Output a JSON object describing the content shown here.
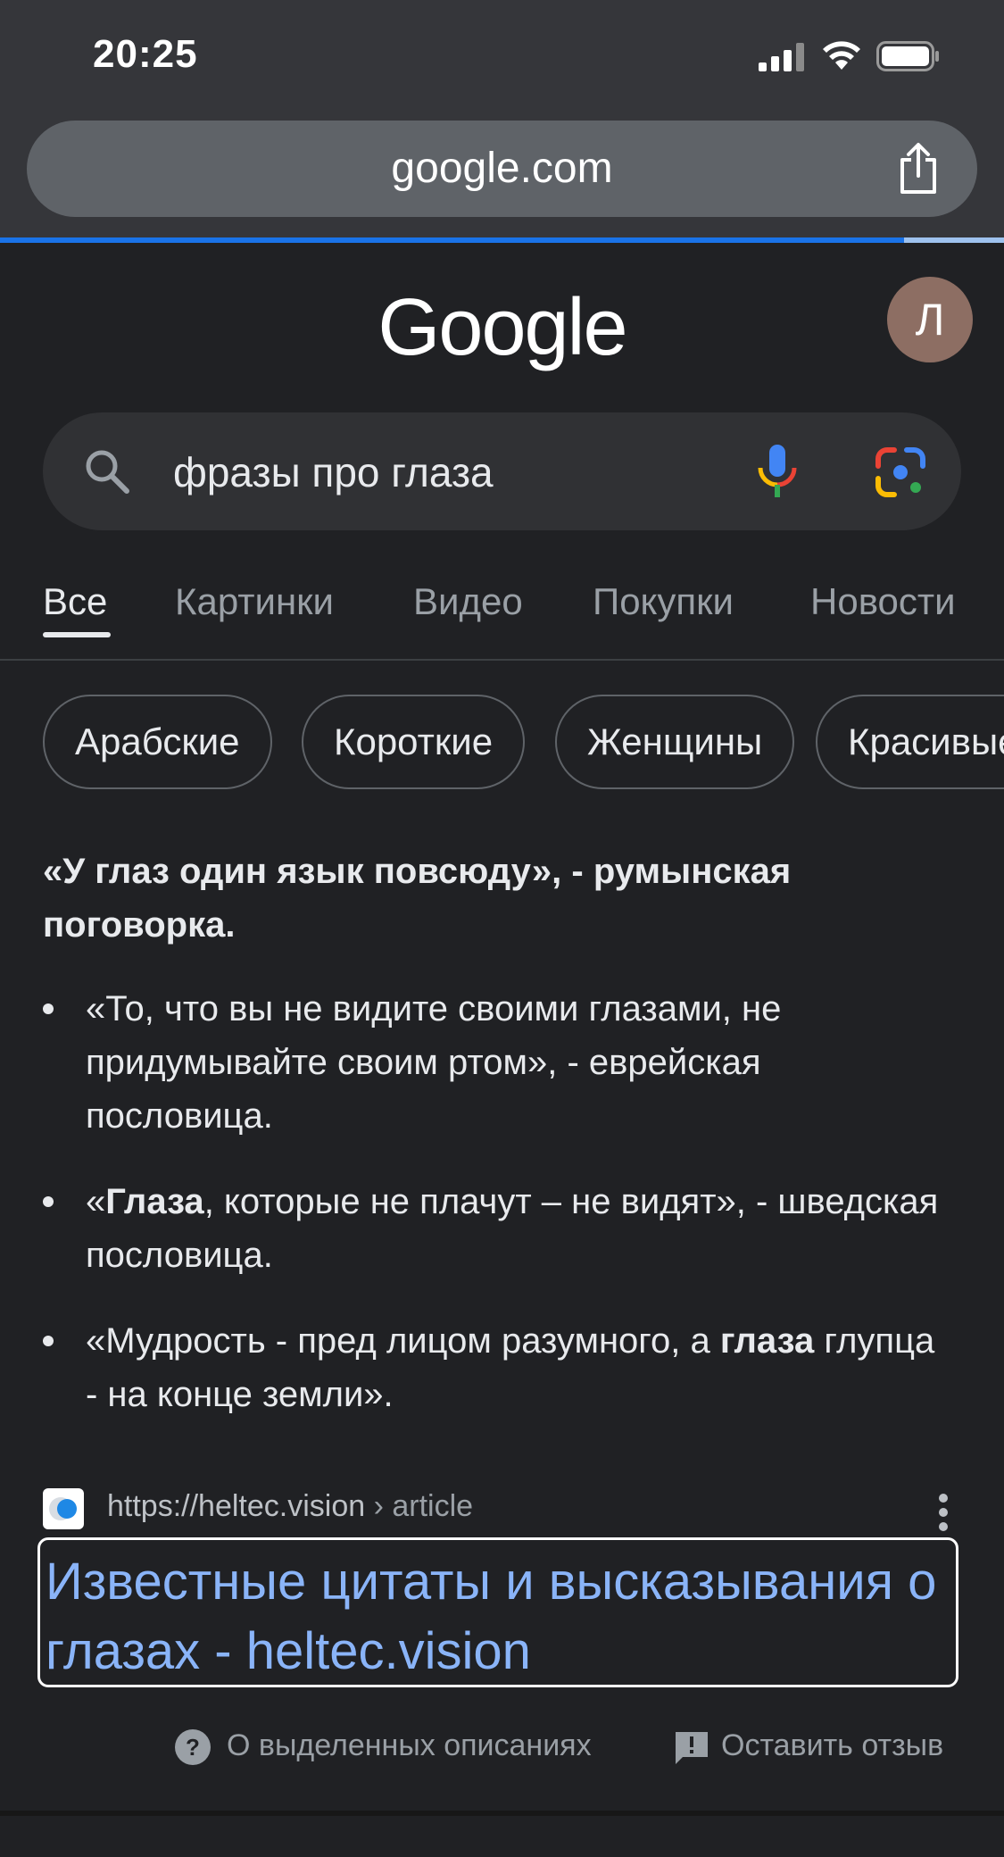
{
  "status_bar": {
    "time": "20:25"
  },
  "browser": {
    "url": "google.com",
    "progress": 0.9
  },
  "header": {
    "logo": "Google",
    "avatar_letter": "Л"
  },
  "search": {
    "query": "фразы про глаза"
  },
  "tabs": [
    {
      "label": "Все",
      "active": true
    },
    {
      "label": "Картинки",
      "active": false
    },
    {
      "label": "Видео",
      "active": false
    },
    {
      "label": "Покупки",
      "active": false
    },
    {
      "label": "Новости",
      "active": false
    }
  ],
  "chips": [
    "Арабские",
    "Короткие",
    "Женщины",
    "Красивые"
  ],
  "snippet": {
    "headline": "«У глаз один язык повсюду», - румынская поговорка.",
    "bullets": [
      {
        "pre": "«То, что вы не видите своими глазами, не придумывайте своим ртом», - еврейская пословица.",
        "bold": "",
        "post": ""
      },
      {
        "pre": "«",
        "bold": "Глаза",
        "post": ", которые не плачут – не видят», - шведская пословица."
      },
      {
        "pre": "«Мудрость - пред лицом разумного, а ",
        "bold": "глаза",
        "post": " глупца - на конце земли»."
      }
    ]
  },
  "source": {
    "url": "https://heltec.vision",
    "crumb": " › article",
    "title": "Известные цитаты и высказывания о глазах - heltec.vision"
  },
  "footer": {
    "about": "О выделенных описаниях",
    "feedback": "Оставить отзыв"
  },
  "colors": {
    "link": "#8ab4f8",
    "background": "#202124",
    "accent": "#1a73e8"
  }
}
